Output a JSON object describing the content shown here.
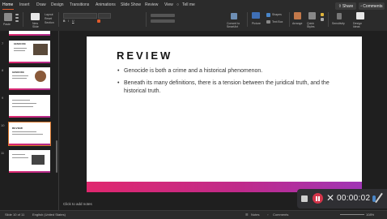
{
  "menu": {
    "tabs": [
      "Home",
      "Insert",
      "Draw",
      "Design",
      "Transitions",
      "Animations",
      "Slide Show",
      "Review",
      "View",
      "Tell me"
    ],
    "share_label": "Share",
    "comments_label": "Comments"
  },
  "ribbon": {
    "paste_label": "Paste",
    "new_slide_label": "New Slide",
    "layout_label": "Layout",
    "reset_label": "Reset",
    "section_label": "Section",
    "convert_label": "Convert to SmartArt",
    "picture_label": "Picture",
    "shapes_label": "Shapes",
    "textbox_label": "Text Box",
    "arrange_label": "Arrange",
    "quick_styles_label": "Quick Styles",
    "sensitivity_label": "Sensitivity",
    "design_ideas_label": "Design Ideas"
  },
  "thumbnails": [
    {
      "num": "6",
      "title": "",
      "selected": false
    },
    {
      "num": "7",
      "title": "GENOCIDE",
      "selected": false
    },
    {
      "num": "8",
      "title": "GENOCIDE",
      "selected": false
    },
    {
      "num": "9",
      "title": "",
      "selected": false
    },
    {
      "num": "10",
      "title": "REVIEW",
      "selected": true
    },
    {
      "num": "11",
      "title": "",
      "selected": false
    }
  ],
  "slide": {
    "title": "REVIEW",
    "bullets": [
      "Genocide is both a crime and a historical phenomenon.",
      "Beneath its many definitions, there is a tension between the juridical truth, and the historical truth."
    ],
    "accent_gradient": [
      "#e0286e",
      "#a035b5"
    ]
  },
  "notes_placeholder": "Click to add notes",
  "status": {
    "slide_info": "Slide 10 of 11",
    "language": "English (United States)",
    "notes_label": "Notes",
    "comments_label": "Comments",
    "zoom": "108%"
  },
  "recorder": {
    "time": "00:00:02"
  }
}
